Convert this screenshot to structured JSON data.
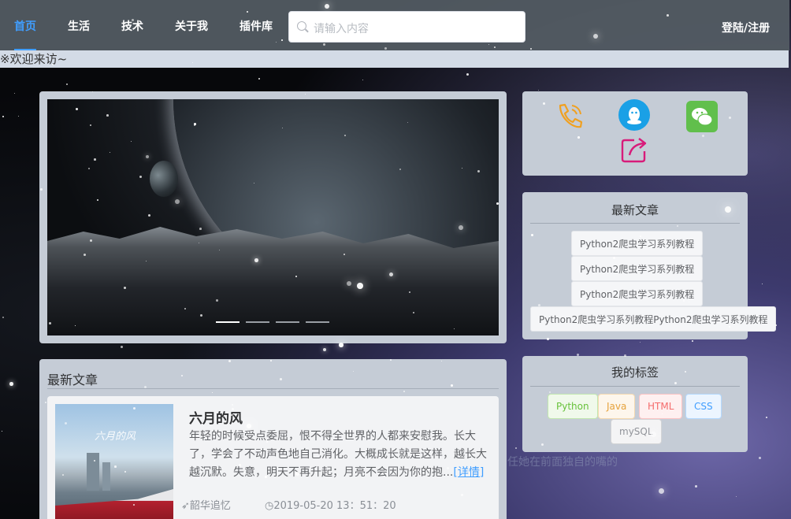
{
  "nav": {
    "items": [
      {
        "label": "首页",
        "active": true
      },
      {
        "label": "生活",
        "active": false
      },
      {
        "label": "技术",
        "active": false
      },
      {
        "label": "关于我",
        "active": false
      },
      {
        "label": "插件库",
        "active": false
      }
    ],
    "search_placeholder": "请输入内容",
    "login_label": "登陆/注册"
  },
  "welcome": "※欢迎来访~",
  "carousel": {
    "indicator_count": 4,
    "active_index": 0
  },
  "latest_articles": {
    "title": "最新文章",
    "articles": [
      {
        "title": "六月的风",
        "excerpt": "年轻的时候受点委屈，恨不得全世界的人都来安慰我。长大了，学会了不动声色地自己消化。大概成长就是这样，越长大越沉默。失意，明天不再升起；月亮不会因为你的抱...",
        "more_label": "[详情]",
        "author": "韶华追忆",
        "date": "2019-05-20 13：51：20",
        "image_caption": "六月的风"
      }
    ]
  },
  "sidebar": {
    "social_icons": [
      "phone-icon",
      "qq-icon",
      "wechat-icon",
      "share-icon"
    ],
    "recent": {
      "title": "最新文章",
      "items": [
        "Python2爬虫学习系列教程",
        "Python2爬虫学习系列教程",
        "Python2爬虫学习系列教程",
        "Python2爬虫学习系列教程Python2爬虫学习系列教程"
      ]
    },
    "tags": {
      "title": "我的标签",
      "items": [
        {
          "label": "Python",
          "color": "#67c23a",
          "bg": "#f0f9eb",
          "border": "#c2e7b0"
        },
        {
          "label": "Java",
          "color": "#e6a23c",
          "bg": "#fdf6ec",
          "border": "#f5dab1"
        },
        {
          "label": "HTML",
          "color": "#f56c6c",
          "bg": "#fef0f0",
          "border": "#fbc4c4"
        },
        {
          "label": "CSS",
          "color": "#409eff",
          "bg": "#ecf5ff",
          "border": "#b3d8ff"
        },
        {
          "label": "mySQL",
          "color": "#909399",
          "bg": "#f4f4f5",
          "border": "#d3d4d6"
        }
      ]
    },
    "overflow_text": "任她在前面独自的嘴的"
  }
}
